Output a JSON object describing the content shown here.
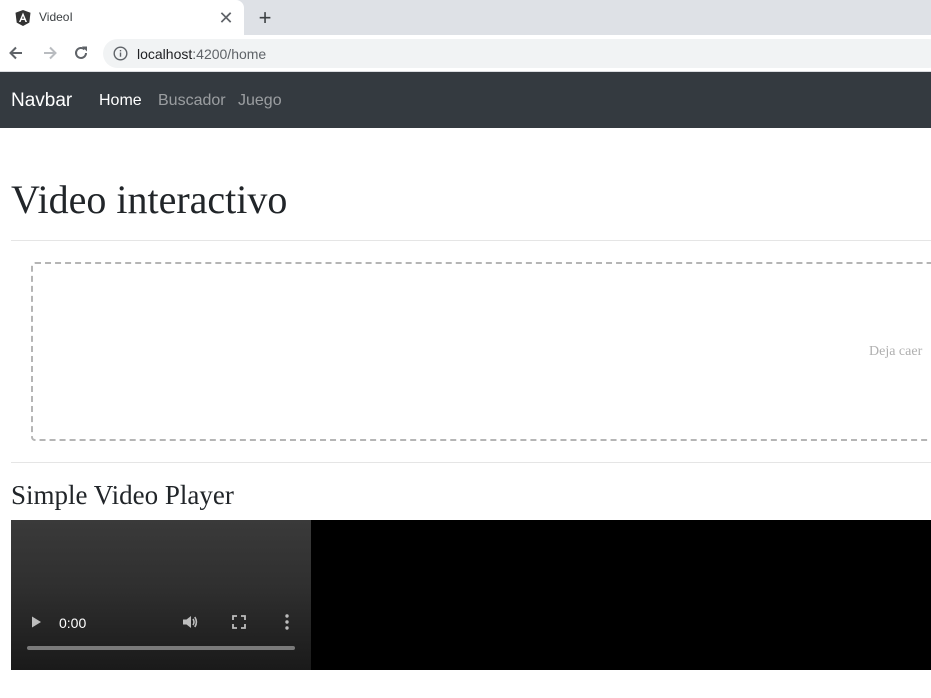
{
  "browser": {
    "tab_title": "VideoI",
    "url_host": "localhost",
    "url_path": ":4200/home",
    "new_tab_symbol": "+",
    "close_symbol": "✕",
    "icons": [
      "angular-logo-icon",
      "close-icon",
      "plus-icon",
      "back-arrow-icon",
      "forward-arrow-icon",
      "reload-icon",
      "info-icon"
    ]
  },
  "navbar": {
    "brand": "Navbar",
    "links": [
      {
        "label": "Home",
        "active": true
      },
      {
        "label": "Buscador",
        "active": false
      },
      {
        "label": "Juego",
        "active": false
      }
    ],
    "background": "#343a40"
  },
  "main": {
    "title": "Video interactivo",
    "dropzone_text": "Deja caer",
    "section_title": "Simple Video Player"
  },
  "video": {
    "time": "0:00",
    "progress": 0,
    "icons": [
      "play-icon",
      "volume-icon",
      "fullscreen-icon",
      "more-options-icon"
    ]
  }
}
